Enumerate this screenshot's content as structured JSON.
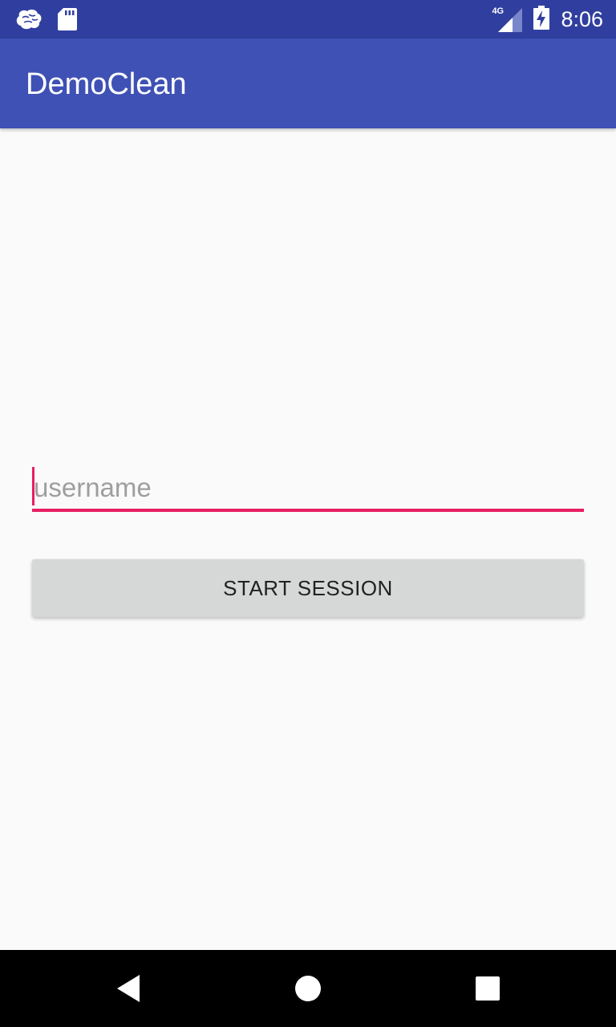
{
  "status_bar": {
    "time": "8:06",
    "network_label": "4G",
    "icons": [
      "brain-icon",
      "sd-card-icon",
      "signal-icon",
      "battery-charging-icon"
    ]
  },
  "app_bar": {
    "title": "DemoClean"
  },
  "form": {
    "username_placeholder": "username",
    "username_value": "",
    "start_button_label": "START SESSION"
  },
  "nav_bar": {
    "icons": [
      "back-icon",
      "home-icon",
      "recents-icon"
    ]
  },
  "colors": {
    "status_bar": "#303f9f",
    "app_bar": "#3f51b5",
    "accent": "#e91e63",
    "button": "#d6d7d7",
    "background": "#fafafa"
  }
}
